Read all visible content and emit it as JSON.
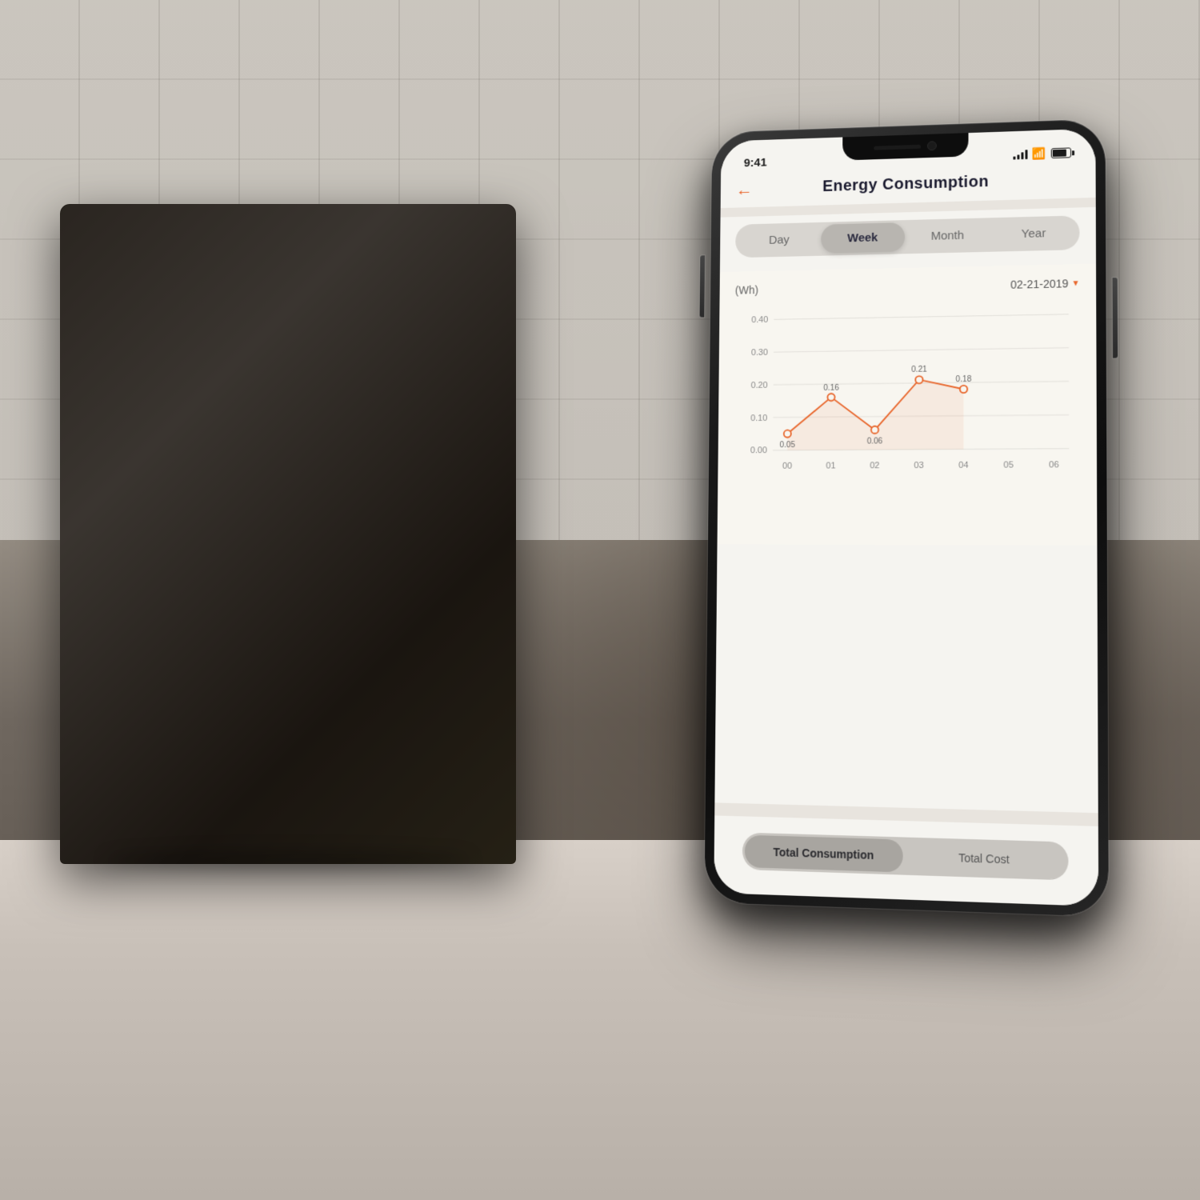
{
  "background": {
    "description": "Kitchen counter with coffee maker background"
  },
  "phone": {
    "status_bar": {
      "time": "9:41",
      "signal_label": "signal",
      "wifi_label": "wifi",
      "battery_label": "battery"
    },
    "header": {
      "back_icon": "←",
      "title": "Energy  Consumption"
    },
    "tabs": {
      "items": [
        "Day",
        "Week",
        "Month",
        "Year"
      ],
      "active_index": 1
    },
    "chart": {
      "unit_label": "(Wh)",
      "date_label": "02-21-2019",
      "y_axis": [
        "0.40",
        "0.30",
        "0.20",
        "0.10",
        "0.00"
      ],
      "x_axis": [
        "00",
        "01",
        "02",
        "03",
        "04",
        "05",
        "06"
      ],
      "data_points": [
        {
          "x": 0,
          "y": 0.05,
          "label": "0.05"
        },
        {
          "x": 1,
          "y": 0.16,
          "label": "0.16"
        },
        {
          "x": 2,
          "y": 0.06,
          "label": "0.06"
        },
        {
          "x": 3,
          "y": 0.21,
          "label": "0.21"
        },
        {
          "x": 4,
          "y": 0.18,
          "label": "0.18"
        }
      ],
      "colors": {
        "line": "#e8652a",
        "dot": "#e8652a",
        "area_fill": "rgba(232,101,42,0.08)"
      }
    },
    "bottom_tabs": {
      "items": [
        "Total Consumption",
        "Total Cost"
      ],
      "active_index": 0
    }
  }
}
